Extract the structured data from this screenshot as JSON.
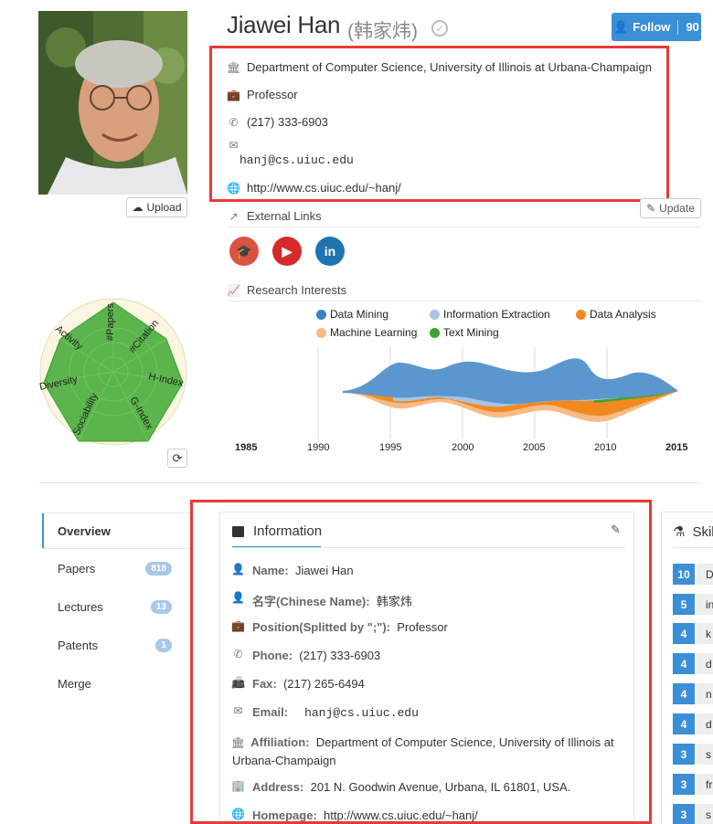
{
  "profile": {
    "name": "Jiawei Han",
    "chinese_name": "(韩家炜)",
    "follow_label": "Follow",
    "follow_count": "90",
    "upload_label": "Upload",
    "update_label": "Update"
  },
  "contact": {
    "affiliation": "Department of Computer Science, University of Illinois at Urbana-Champaign",
    "position": "Professor",
    "phone": "(217) 333-6903",
    "email": "hanj@cs.uiuc.edu",
    "homepage": "http://www.cs.uiuc.edu/~hanj/"
  },
  "external_links": {
    "title": "External Links",
    "icons": [
      "scholar-icon",
      "youtube-icon",
      "linkedin-icon"
    ],
    "colors": [
      "#d9533f",
      "#d62a2a",
      "#1d74b0"
    ]
  },
  "research": {
    "title": "Research Interests",
    "legend": [
      {
        "label": "Data Mining",
        "color": "#3b82c4"
      },
      {
        "label": "Information Extraction",
        "color": "#a8c4e4"
      },
      {
        "label": "Data Analysis",
        "color": "#f2891f"
      },
      {
        "label": "Machine Learning",
        "color": "#f8bb86"
      },
      {
        "label": "Text Mining",
        "color": "#3aa534"
      }
    ],
    "axis_ticks": [
      "1985",
      "1990",
      "1995",
      "2000",
      "2005",
      "2010",
      "2015"
    ]
  },
  "radar": {
    "labels": [
      "#Papers",
      "#Citation",
      "H-Index",
      "G-Index",
      "Sociability",
      "Diversity",
      "Activity"
    ]
  },
  "nav": {
    "items": [
      {
        "label": "Overview",
        "badge": ""
      },
      {
        "label": "Papers",
        "badge": "818"
      },
      {
        "label": "Lectures",
        "badge": "13"
      },
      {
        "label": "Patents",
        "badge": "1"
      },
      {
        "label": "Merge",
        "badge": ""
      }
    ]
  },
  "info_card": {
    "title": "Information",
    "fields": [
      {
        "label": "Name:",
        "value": "Jiawei Han"
      },
      {
        "label": "名字(Chinese Name):",
        "value": "韩家炜"
      },
      {
        "label": "Position(Splitted by \";\"):",
        "value": "Professor"
      },
      {
        "label": "Phone:",
        "value": "(217) 333-6903"
      },
      {
        "label": "Fax:",
        "value": "(217) 265-6494"
      },
      {
        "label": "Email:",
        "value": "hanj@cs.uiuc.edu"
      },
      {
        "label": "Affiliation:",
        "value": "Department of Computer Science, University of Illinois at Urbana-Champaign"
      },
      {
        "label": "Address:",
        "value": "201 N. Goodwin Avenue, Urbana, IL 61801, USA."
      },
      {
        "label": "Homepage:",
        "value": "http://www.cs.uiuc.edu/~hanj/"
      }
    ]
  },
  "skills": {
    "title": "Skil",
    "items": [
      {
        "count": "10",
        "label": "D"
      },
      {
        "count": "5",
        "label": "in"
      },
      {
        "count": "4",
        "label": "k"
      },
      {
        "count": "4",
        "label": "d"
      },
      {
        "count": "4",
        "label": "n"
      },
      {
        "count": "4",
        "label": "d"
      },
      {
        "count": "3",
        "label": "s"
      },
      {
        "count": "3",
        "label": "fr"
      },
      {
        "count": "3",
        "label": "s"
      }
    ]
  }
}
